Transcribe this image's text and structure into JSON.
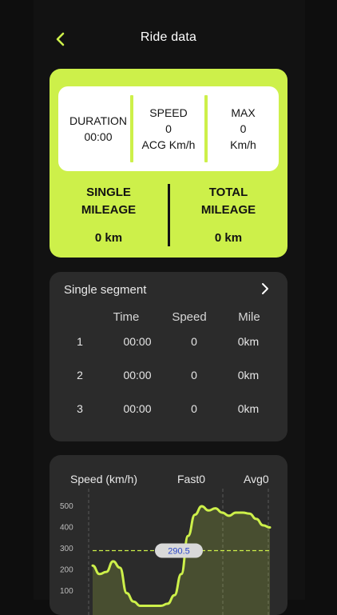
{
  "header": {
    "title": "Ride data"
  },
  "summary": {
    "duration": {
      "label": "DURATION",
      "value": "00:00"
    },
    "speed": {
      "label": "SPEED",
      "value": "0",
      "unit": "ACG Km/h"
    },
    "max": {
      "label": "MAX",
      "value": "0",
      "unit": "Km/h"
    },
    "single_mileage": {
      "label_line1": "SINGLE",
      "label_line2": "MILEAGE",
      "value": "0 km"
    },
    "total_mileage": {
      "label_line1": "TOTAL",
      "label_line2": "MILEAGE",
      "value": "0 km"
    }
  },
  "segments": {
    "title": "Single segment",
    "columns": [
      "Time",
      "Speed",
      "Mile"
    ],
    "rows": [
      {
        "index": "1",
        "time": "00:00",
        "speed": "0",
        "mile": "0km"
      },
      {
        "index": "2",
        "time": "00:00",
        "speed": "0",
        "mile": "0km"
      },
      {
        "index": "3",
        "time": "00:00",
        "speed": "0",
        "mile": "0km"
      }
    ]
  },
  "speed_chart": {
    "title": "Speed (km/h)",
    "fast_label": "Fast0",
    "avg_label": "Avg0"
  },
  "colors": {
    "accent": "#cdf04a",
    "card": "#2b2b2b",
    "background": "#121212"
  },
  "chart_data": {
    "type": "line",
    "ylim": [
      50,
      570
    ],
    "y_ticks": [
      100,
      200,
      300,
      400,
      500
    ],
    "reference_line": {
      "value": 290.5,
      "label": "290.5"
    },
    "x": [
      0,
      1,
      2,
      3,
      4,
      5,
      6,
      7,
      8,
      9,
      10,
      11,
      12,
      13,
      14,
      15,
      16,
      17,
      18,
      19,
      20,
      21,
      22,
      23,
      24,
      25,
      26
    ],
    "values": [
      220,
      180,
      190,
      240,
      210,
      90,
      50,
      30,
      30,
      30,
      30,
      40,
      80,
      180,
      360,
      460,
      500,
      480,
      490,
      470,
      455,
      470,
      470,
      465,
      440,
      410,
      400
    ]
  }
}
